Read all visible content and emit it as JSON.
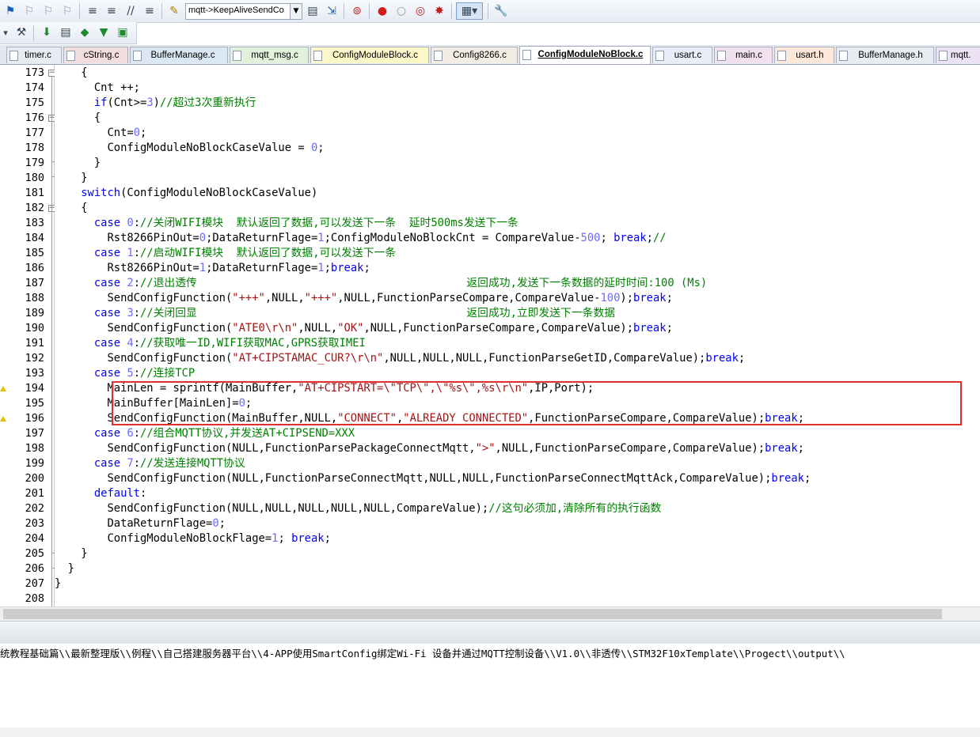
{
  "toolbar": {
    "target_combo": "mqtt->KeepAliveSendCo",
    "buttons": [
      "flag-icon",
      "bookmark-prev-icon",
      "bookmark-next-icon",
      "bookmark-clear-icon",
      "indent-icon",
      "unindent-icon",
      "comment-icon",
      "uncomment-icon",
      "open-file-icon",
      "find-in-files-icon",
      "debug-icon",
      "breakpoint-icon",
      "breakpoint-disable-icon",
      "breakpoint-kill-icon",
      "windows-icon",
      "settings-icon"
    ]
  },
  "toolbar2": {
    "buttons": [
      "build-icon",
      "download-icon",
      "load-icon",
      "translate-icon",
      "rebuild-icon",
      "batch-build-icon"
    ]
  },
  "tabs": [
    {
      "label": "timer.c",
      "active": false
    },
    {
      "label": "cString.c",
      "active": false
    },
    {
      "label": "BufferManage.c",
      "active": false
    },
    {
      "label": "mqtt_msg.c",
      "active": false
    },
    {
      "label": "ConfigModuleBlock.c",
      "active": false
    },
    {
      "label": "Config8266.c",
      "active": false
    },
    {
      "label": "ConfigModuleNoBlock.c",
      "active": true
    },
    {
      "label": "usart.c",
      "active": false
    },
    {
      "label": "main.c",
      "active": false
    },
    {
      "label": "usart.h",
      "active": false
    },
    {
      "label": "BufferManage.h",
      "active": false
    },
    {
      "label": "mqtt.",
      "active": false
    }
  ],
  "editor": {
    "lines": [
      {
        "n": "173",
        "code": "    {"
      },
      {
        "n": "174",
        "code": "      Cnt ++;"
      },
      {
        "n": "175",
        "code": "      if(Cnt>=3)//超过3次重新执行"
      },
      {
        "n": "176",
        "code": "      {"
      },
      {
        "n": "177",
        "code": "        Cnt=0;"
      },
      {
        "n": "178",
        "code": "        ConfigModuleNoBlockCaseValue = 0;"
      },
      {
        "n": "179",
        "code": "      }"
      },
      {
        "n": "180",
        "code": "    }"
      },
      {
        "n": "181",
        "code": "    switch(ConfigModuleNoBlockCaseValue)"
      },
      {
        "n": "182",
        "code": "    {"
      },
      {
        "n": "183",
        "code": "      case 0://关闭WIFI模块  默认返回了数据,可以发送下一条  延时500ms发送下一条"
      },
      {
        "n": "184",
        "code": "        Rst8266PinOut=0;DataReturnFlage=1;ConfigModuleNoBlockCnt = CompareValue-500; break;//"
      },
      {
        "n": "185",
        "code": "      case 1://启动WIFI模块  默认返回了数据,可以发送下一条"
      },
      {
        "n": "186",
        "code": "        Rst8266PinOut=1;DataReturnFlage=1;break;"
      },
      {
        "n": "187",
        "code": "      case 2://退出透传                                         返回成功,发送下一条数据的延时时间:100 (Ms)"
      },
      {
        "n": "188",
        "code": "        SendConfigFunction(\"+++\",NULL,\"+++\",NULL,FunctionParseCompare,CompareValue-100);break;"
      },
      {
        "n": "189",
        "code": "      case 3://关闭回显                                         返回成功,立即发送下一条数据"
      },
      {
        "n": "190",
        "code": "        SendConfigFunction(\"ATE0\\r\\n\",NULL,\"OK\",NULL,FunctionParseCompare,CompareValue);break;"
      },
      {
        "n": "191",
        "code": "      case 4://获取唯一ID,WIFI获取MAC,GPRS获取IMEI"
      },
      {
        "n": "192",
        "code": "        SendConfigFunction(\"AT+CIPSTAMAC_CUR?\\r\\n\",NULL,NULL,NULL,FunctionParseGetID,CompareValue);break;"
      },
      {
        "n": "193",
        "code": "      case 5://连接TCP"
      },
      {
        "n": "194",
        "code": "        MainLen = sprintf(MainBuffer,\"AT+CIPSTART=\\\"TCP\\\",\\\"%s\\\",%s\\r\\n\",IP,Port);"
      },
      {
        "n": "195",
        "code": "        MainBuffer[MainLen]=0;"
      },
      {
        "n": "196",
        "code": "        SendConfigFunction(MainBuffer,NULL,\"CONNECT\",\"ALREADY CONNECTED\",FunctionParseCompare,CompareValue);break;"
      },
      {
        "n": "197",
        "code": "      case 6://组合MQTT协议,并发送AT+CIPSEND=XXX"
      },
      {
        "n": "198",
        "code": "        SendConfigFunction(NULL,FunctionParsePackageConnectMqtt,\">\",NULL,FunctionParseCompare,CompareValue);break;"
      },
      {
        "n": "199",
        "code": "      case 7://发送连接MQTT协议"
      },
      {
        "n": "200",
        "code": "        SendConfigFunction(NULL,FunctionParseConnectMqtt,NULL,NULL,FunctionParseConnectMqttAck,CompareValue);break;"
      },
      {
        "n": "201",
        "code": "      default:"
      },
      {
        "n": "202",
        "code": "        SendConfigFunction(NULL,NULL,NULL,NULL,NULL,CompareValue);//这句必须加,清除所有的执行函数"
      },
      {
        "n": "203",
        "code": "        DataReturnFlage=0;"
      },
      {
        "n": "204",
        "code": "        ConfigModuleNoBlockFlage=1; break;"
      },
      {
        "n": "205",
        "code": "    }"
      },
      {
        "n": "206",
        "code": "  }"
      },
      {
        "n": "207",
        "code": "}"
      },
      {
        "n": "208",
        "code": ""
      }
    ]
  },
  "output": {
    "text": "统教程基础篇\\\\最新整理版\\\\例程\\\\自己搭建服务器平台\\\\4-APP使用SmartConfig绑定Wi-Fi 设备并通过MQTT控制设备\\\\V1.0\\\\非透传\\\\STM32F10xTemplate\\\\Progect\\\\output\\\\"
  }
}
